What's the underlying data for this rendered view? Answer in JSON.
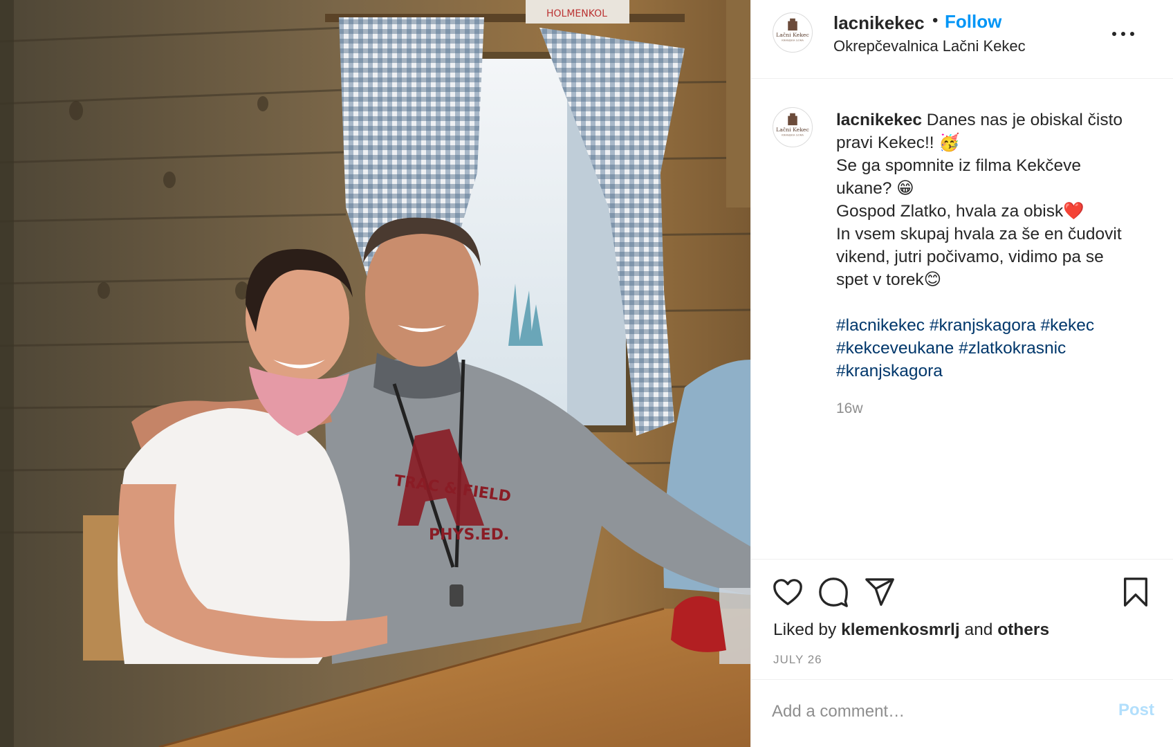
{
  "header": {
    "username": "lacnikekec",
    "separator": "•",
    "follow_label": "Follow",
    "location": "Okrepčevalnica Lačni Kekec"
  },
  "avatar": {
    "name": "Lačni Kekec",
    "sub": "KRANJSKA GORA"
  },
  "photo": {
    "shirt_line1": "TRAC & FIELD",
    "shirt_line2": "PHYS.ED."
  },
  "caption": {
    "username": "lacnikekec",
    "lines": [
      "Danes nas je obiskal čisto",
      "pravi Kekec!! 🥳",
      "Se ga spomnite iz filma Kekčeve",
      "ukane? 😁",
      "Gospod Zlatko, hvala za obisk❤️",
      "In vsem skupaj hvala za še en čudovit",
      "vikend, jutri počivamo, vidimo pa se",
      "spet v torek😊"
    ],
    "hashtags": [
      "#lacnikekec",
      "#kranjskagora",
      "#kekec",
      "#kekceveukane",
      "#zlatkokrasnic",
      "#kranjskagora"
    ],
    "time_ago": "16w"
  },
  "actions": {
    "icons": [
      "heart-icon",
      "comment-icon",
      "share-icon",
      "bookmark-icon"
    ],
    "liked_by_prefix": "Liked by",
    "liked_by_user": "klemenkosmrlj",
    "liked_by_and": "and",
    "liked_by_others": "others",
    "date": "JULY 26"
  },
  "comment": {
    "placeholder": "Add a comment…",
    "post_label": "Post"
  },
  "colors": {
    "accent": "#0095f6",
    "hashtag": "#00376b",
    "muted": "#8e8e8e",
    "post_disabled": "#b2dffc"
  }
}
